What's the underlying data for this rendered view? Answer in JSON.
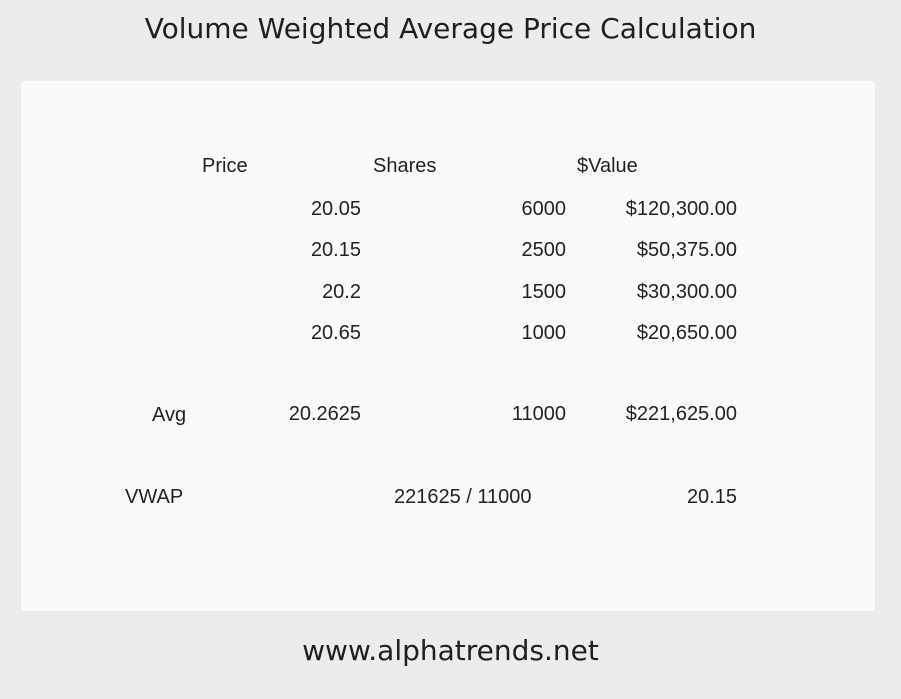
{
  "title": "Volume Weighted Average Price Calculation",
  "footer": "www.alphatrends.net",
  "table": {
    "headers": {
      "price": "Price",
      "shares": "Shares",
      "value": "$Value"
    },
    "rows": [
      {
        "price": "20.05",
        "shares": "6000",
        "value": "$120,300.00"
      },
      {
        "price": "20.15",
        "shares": "2500",
        "value": "$50,375.00"
      },
      {
        "price": "20.2",
        "shares": "1500",
        "value": "$30,300.00"
      },
      {
        "price": "20.65",
        "shares": "1000",
        "value": "$20,650.00"
      }
    ],
    "avg": {
      "label": "Avg",
      "price": "20.2625",
      "shares": "11000",
      "value": "$221,625.00"
    },
    "vwap": {
      "label": "VWAP",
      "formula": "221625 / 11000",
      "value": "20.15"
    }
  }
}
